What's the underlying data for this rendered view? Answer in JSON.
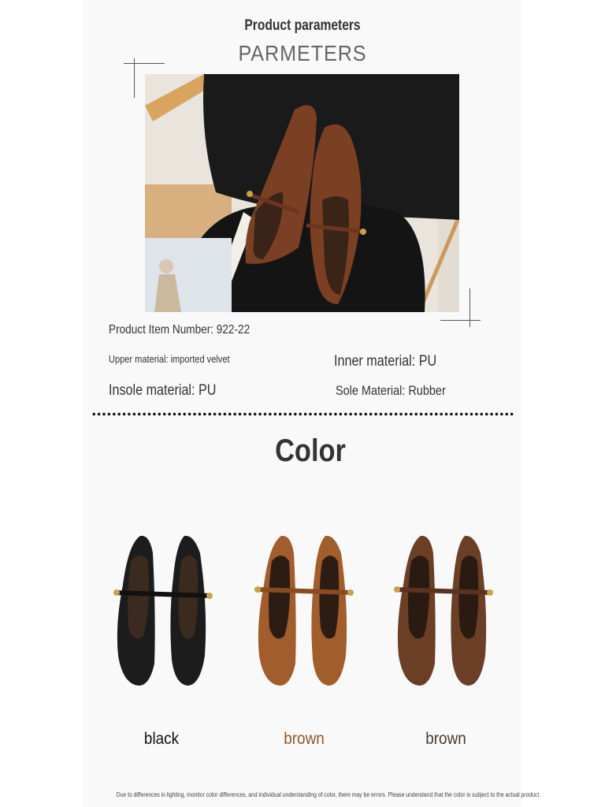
{
  "header": {
    "title_cn": "Product parameters",
    "title_en": "PARMETERS"
  },
  "product_photo": {
    "icon": "shoe-photo-icon"
  },
  "params": {
    "item_number": "Product Item Number: 922-22",
    "upper_material": "Upper material: imported velvet",
    "inner_material": "Inner material: PU",
    "insole_material": "Insole material: PU",
    "sole_material": "Sole Material: Rubber"
  },
  "color_section": {
    "heading": "Color",
    "options": [
      {
        "label": "black",
        "color": "#1c1c1c",
        "label_color": "#111111"
      },
      {
        "label": "brown",
        "color": "#a25d2c",
        "label_color": "#8a5a28"
      },
      {
        "label": "brown",
        "color": "#6b3f26",
        "label_color": "#4a3a30"
      }
    ]
  },
  "disclaimer": "Due to differences in lighting, monitor color differences, and individual understanding of color, there may be errors. Please understand that the color is subject to the actual product."
}
